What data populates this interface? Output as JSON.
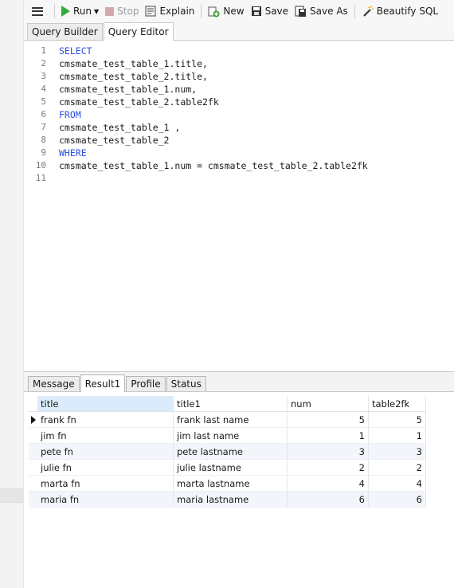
{
  "toolbar": {
    "menu_icon": "hamburger-menu-icon",
    "run_label": "Run",
    "stop_label": "Stop",
    "explain_label": "Explain",
    "new_label": "New",
    "save_label": "Save",
    "save_as_label": "Save As",
    "beautify_label": "Beautify SQL"
  },
  "editor_tabs": [
    {
      "label": "Query Builder",
      "active": false
    },
    {
      "label": "Query Editor",
      "active": true
    }
  ],
  "editor": {
    "lines": [
      {
        "n": "1",
        "text": "SELECT",
        "keyword": true
      },
      {
        "n": "2",
        "text": "cmsmate_test_table_1.title,",
        "keyword": false
      },
      {
        "n": "3",
        "text": "cmsmate_test_table_2.title,",
        "keyword": false
      },
      {
        "n": "4",
        "text": "cmsmate_test_table_1.num,",
        "keyword": false
      },
      {
        "n": "5",
        "text": "cmsmate_test_table_2.table2fk",
        "keyword": false
      },
      {
        "n": "6",
        "text": "FROM",
        "keyword": true
      },
      {
        "n": "7",
        "text": "cmsmate_test_table_1 ,",
        "keyword": false
      },
      {
        "n": "8",
        "text": "cmsmate_test_table_2",
        "keyword": false
      },
      {
        "n": "9",
        "text": "WHERE",
        "keyword": true
      },
      {
        "n": "10",
        "text": "cmsmate_test_table_1.num = cmsmate_test_table_2.table2fk",
        "keyword": false
      },
      {
        "n": "11",
        "text": "",
        "keyword": false
      }
    ]
  },
  "result_tabs": [
    {
      "label": "Message",
      "active": false
    },
    {
      "label": "Result1",
      "active": true
    },
    {
      "label": "Profile",
      "active": false
    },
    {
      "label": "Status",
      "active": false
    }
  ],
  "results": {
    "columns": [
      "title",
      "title1",
      "num",
      "table2fk"
    ],
    "rows": [
      [
        "frank fn",
        "frank last name",
        "5",
        "5"
      ],
      [
        "jim fn",
        "jim last name",
        "1",
        "1"
      ],
      [
        "pete fn",
        "pete lastname",
        "3",
        "3"
      ],
      [
        "julie fn",
        "julie lastname",
        "2",
        "2"
      ],
      [
        "marta fn",
        "marta lastname",
        "4",
        "4"
      ],
      [
        "maria fn",
        "maria lastname",
        "6",
        "6"
      ]
    ],
    "current_row": 0
  },
  "colors": {
    "keyword": "#2b4fe0",
    "run_icon": "#38a838",
    "selected_header": "#dcebfb"
  }
}
